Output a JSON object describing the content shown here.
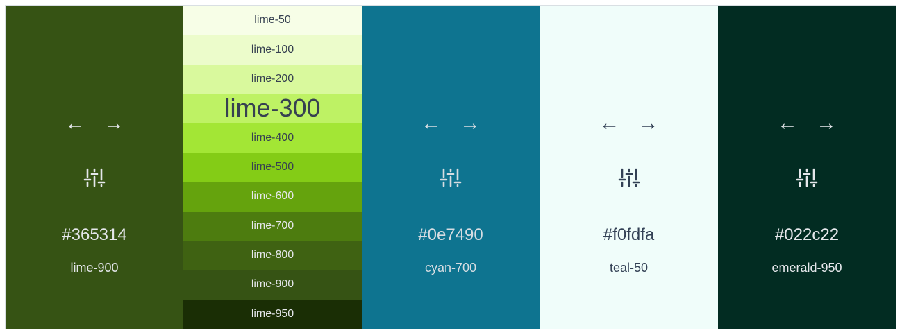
{
  "palette": [
    {
      "hex": "#365314",
      "name": "lime-900",
      "bg": "#365314",
      "fg": "#e5e7eb"
    },
    {
      "hex": "#0e7490",
      "name": "cyan-700",
      "bg": "#0e7490",
      "fg": "#d7dde2"
    },
    {
      "hex": "#f0fdfa",
      "name": "teal-50",
      "bg": "#f0fdfa",
      "fg": "#334155"
    },
    {
      "hex": "#022c22",
      "name": "emerald-950",
      "bg": "#022c22",
      "fg": "#e5e7eb"
    }
  ],
  "arrows": {
    "left": "←",
    "right": "→"
  },
  "lime_shades": [
    {
      "label": "lime-50",
      "bg": "#f7fee7",
      "fg": "#374151"
    },
    {
      "label": "lime-100",
      "bg": "#ecfccb",
      "fg": "#374151"
    },
    {
      "label": "lime-200",
      "bg": "#d9f99d",
      "fg": "#374151"
    },
    {
      "label": "lime-300",
      "bg": "#bef264",
      "fg": "#374151",
      "active": true
    },
    {
      "label": "lime-400",
      "bg": "#a3e635",
      "fg": "#374151"
    },
    {
      "label": "lime-500",
      "bg": "#84cc16",
      "fg": "#374151"
    },
    {
      "label": "lime-600",
      "bg": "#65a30d",
      "fg": "#e5e7eb"
    },
    {
      "label": "lime-700",
      "bg": "#4d7c0f",
      "fg": "#e5e7eb"
    },
    {
      "label": "lime-800",
      "bg": "#3f6212",
      "fg": "#e5e7eb"
    },
    {
      "label": "lime-900",
      "bg": "#365314",
      "fg": "#e5e7eb"
    },
    {
      "label": "lime-950",
      "bg": "#1a2e05",
      "fg": "#e5e7eb"
    }
  ]
}
